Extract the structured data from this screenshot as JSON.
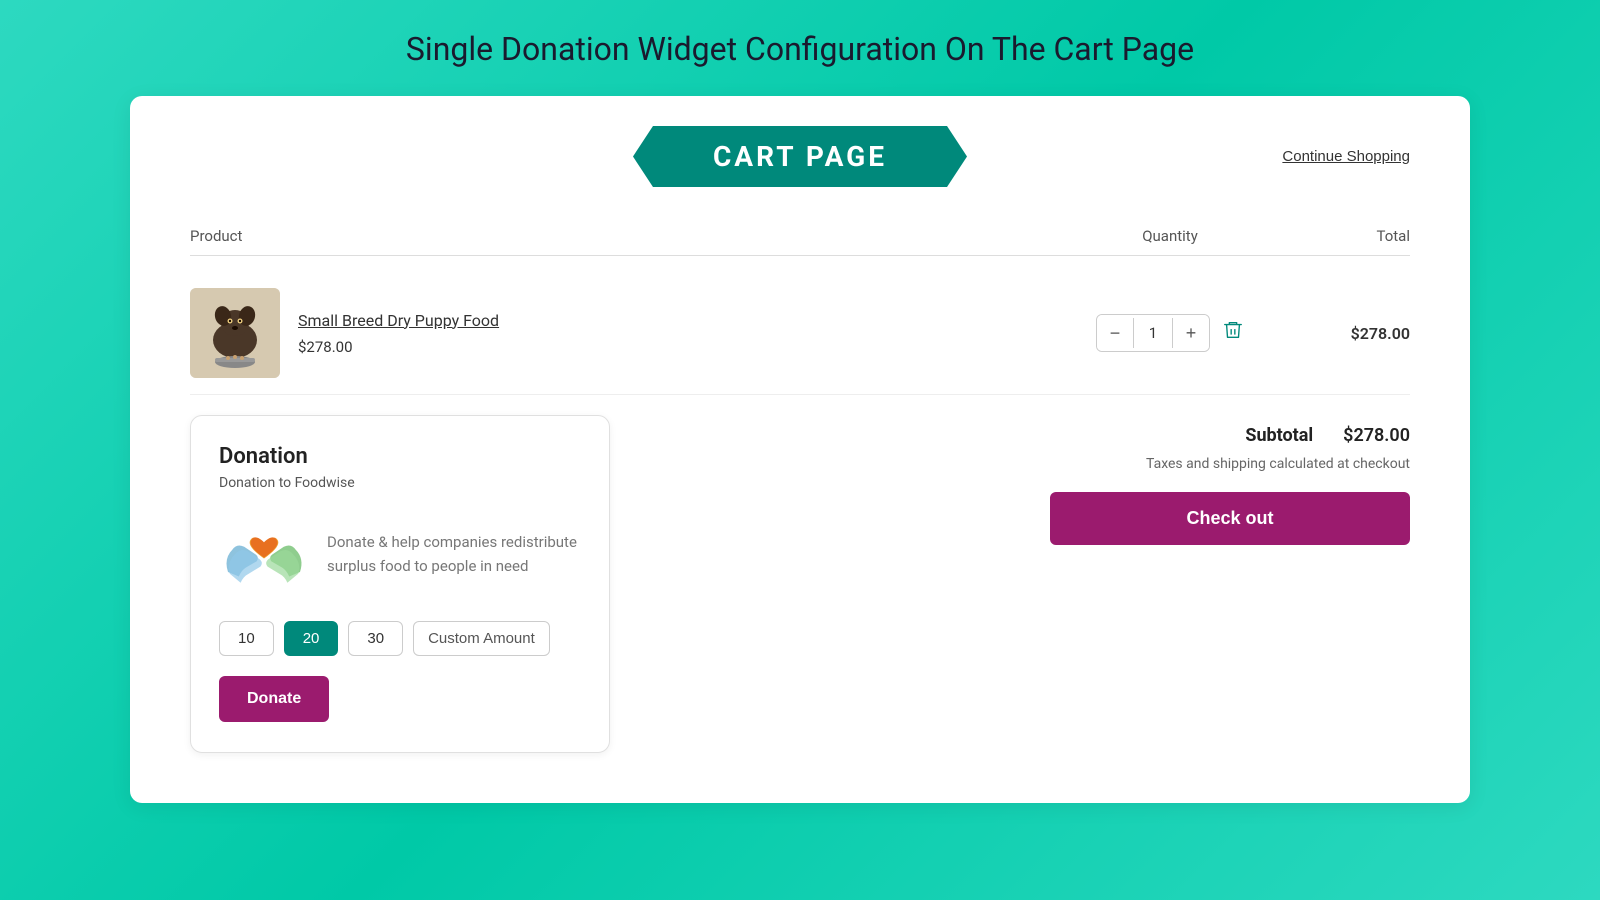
{
  "page": {
    "title": "Single Donation Widget Configuration On The Cart Page"
  },
  "header": {
    "cart_banner": "CART PAGE",
    "continue_shopping": "Continue Shopping"
  },
  "table": {
    "col_product": "Product",
    "col_quantity": "Quantity",
    "col_total": "Total"
  },
  "cart": {
    "product_name": "Small Breed Dry Puppy Food",
    "product_price": "$278.00",
    "quantity": "1",
    "total": "$278.00"
  },
  "donation": {
    "title": "Donation",
    "subtitle": "Donation to Foodwise",
    "description": "Donate & help companies redistribute surplus food to people in need",
    "amounts": [
      "10",
      "20",
      "30"
    ],
    "active_amount": "20",
    "custom_label": "Custom Amount",
    "donate_btn": "Donate"
  },
  "summary": {
    "subtotal_label": "Subtotal",
    "subtotal_value": "$278.00",
    "taxes_note": "Taxes and shipping calculated at checkout",
    "checkout_btn": "Check out"
  }
}
